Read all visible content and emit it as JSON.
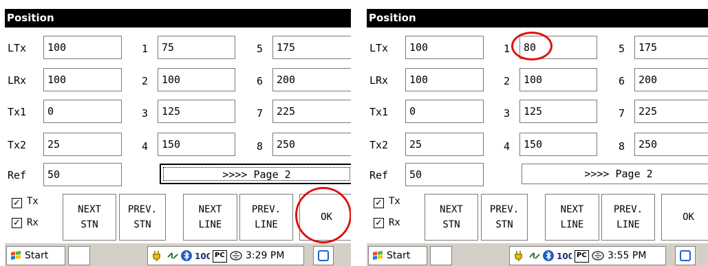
{
  "screens": [
    {
      "title": "Position",
      "left_labels": [
        "LTx",
        "LRx",
        "Tx1",
        "Tx2",
        "Ref"
      ],
      "left_values": [
        "100",
        "100",
        "0",
        "25",
        "50"
      ],
      "mid_labels": [
        "1",
        "2",
        "3",
        "4"
      ],
      "mid_values": [
        "75",
        "100",
        "125",
        "150"
      ],
      "right_labels": [
        "5",
        "6",
        "7",
        "8"
      ],
      "right_values": [
        "175",
        "200",
        "225",
        "250"
      ],
      "page_button": ">>>> Page 2",
      "checkbox_tx": {
        "label": "Tx",
        "checked": true
      },
      "checkbox_rx": {
        "label": "Rx",
        "checked": true
      },
      "buttons": [
        {
          "line1": "NEXT",
          "line2": "STN"
        },
        {
          "line1": "PREV.",
          "line2": "STN"
        },
        {
          "line1": "NEXT",
          "line2": "LINE"
        },
        {
          "line1": "PREV.",
          "line2": "LINE"
        }
      ],
      "ok_label": "OK",
      "start_label": "Start",
      "clock": "3:29 PM",
      "pc_badge": "PC",
      "annotation_color": "#e01010"
    },
    {
      "title": "Position",
      "left_labels": [
        "LTx",
        "LRx",
        "Tx1",
        "Tx2",
        "Ref"
      ],
      "left_values": [
        "100",
        "100",
        "0",
        "25",
        "50"
      ],
      "mid_labels": [
        "1",
        "2",
        "3",
        "4"
      ],
      "mid_values": [
        "80",
        "100",
        "125",
        "150"
      ],
      "right_labels": [
        "5",
        "6",
        "7",
        "8"
      ],
      "right_values": [
        "175",
        "200",
        "225",
        "250"
      ],
      "page_button": ">>>> Page 2",
      "checkbox_tx": {
        "label": "Tx",
        "checked": true
      },
      "checkbox_rx": {
        "label": "Rx",
        "checked": true
      },
      "buttons": [
        {
          "line1": "NEXT",
          "line2": "STN"
        },
        {
          "line1": "PREV.",
          "line2": "STN"
        },
        {
          "line1": "NEXT",
          "line2": "LINE"
        },
        {
          "line1": "PREV.",
          "line2": "LINE"
        }
      ],
      "ok_label": "OK",
      "start_label": "Start",
      "clock": "3:55 PM",
      "pc_badge": "PC",
      "annotation_color": "#e01010"
    }
  ]
}
